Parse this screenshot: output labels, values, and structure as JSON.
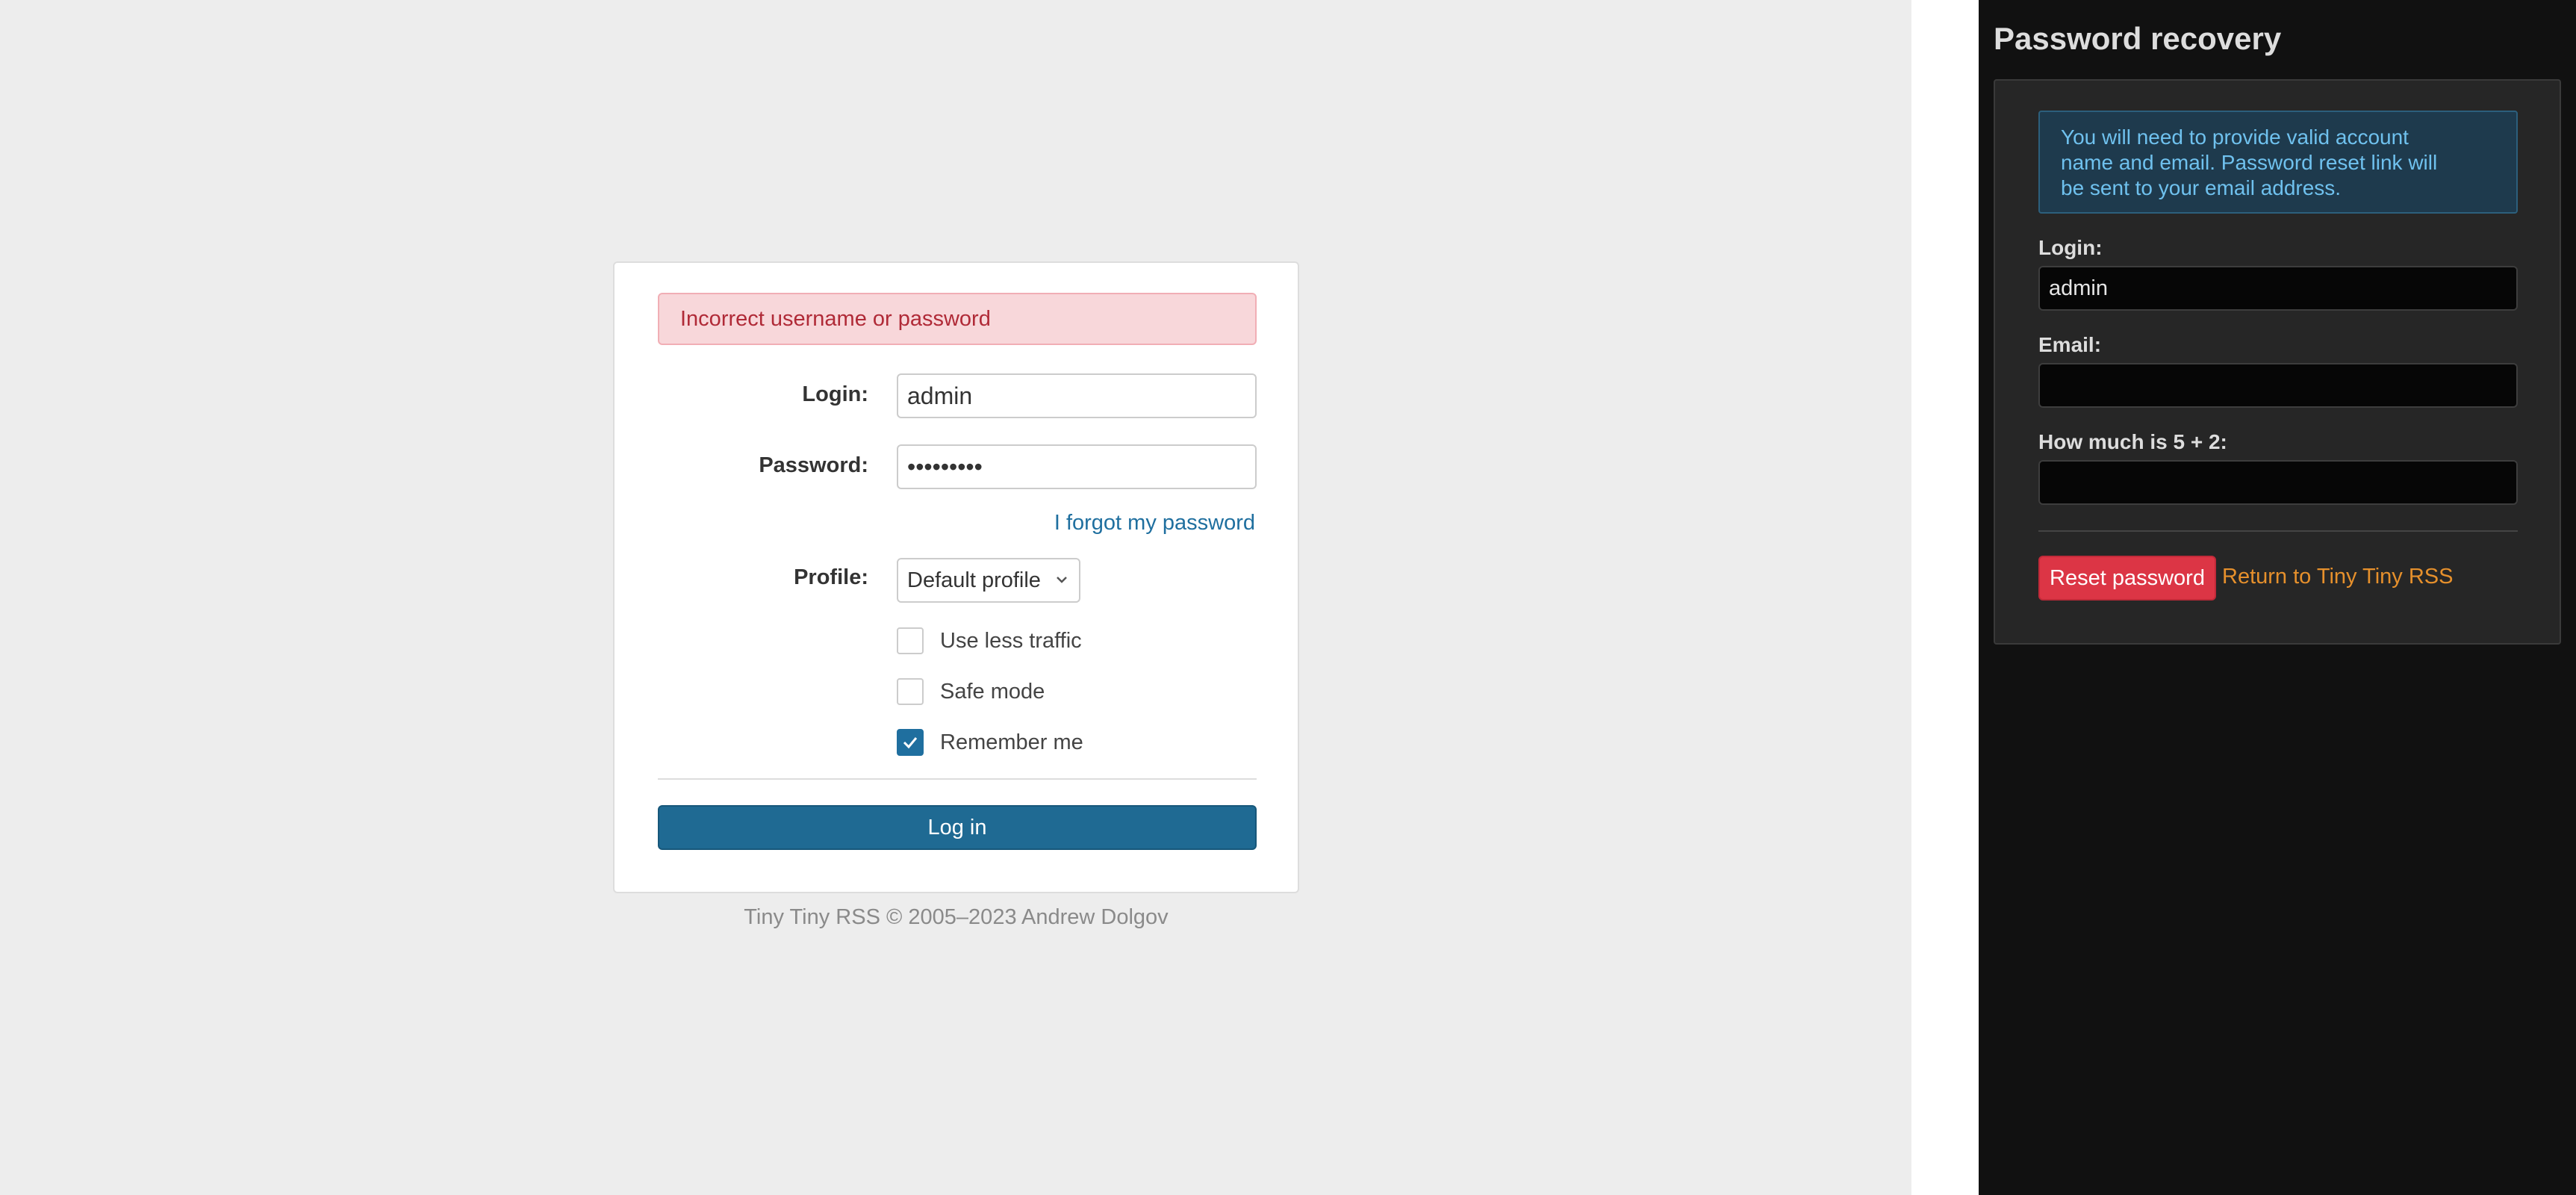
{
  "login_form": {
    "error_message": "Incorrect username or password",
    "login_label": "Login:",
    "login_value": "admin",
    "password_label": "Password:",
    "password_value": "•••••••••",
    "forgot_link": "I forgot my password",
    "profile_label": "Profile:",
    "profile_selected": "Default profile",
    "checkboxes": [
      {
        "label": "Use less traffic",
        "checked": false
      },
      {
        "label": "Safe mode",
        "checked": false
      },
      {
        "label": "Remember me",
        "checked": true
      }
    ],
    "login_button": "Log in",
    "footer": "Tiny Tiny RSS © 2005–2023 Andrew Dolgov"
  },
  "recovery": {
    "title": "Password recovery",
    "notice_lines": [
      "You will need to provide valid account",
      "name and email. Password reset link will",
      "be sent to your email address."
    ],
    "login_label": "Login:",
    "login_value": "admin",
    "email_label": "Email:",
    "email_value": "",
    "captcha_label": "How much is 5 + 2:",
    "captcha_value": "",
    "reset_button": "Reset password",
    "return_link": "Return to Tiny Tiny RSS"
  },
  "colors": {
    "accent_blue": "#1f6a93",
    "error_red": "#b02a37",
    "reset_red": "#dc3545",
    "return_orange": "#e6902c"
  }
}
